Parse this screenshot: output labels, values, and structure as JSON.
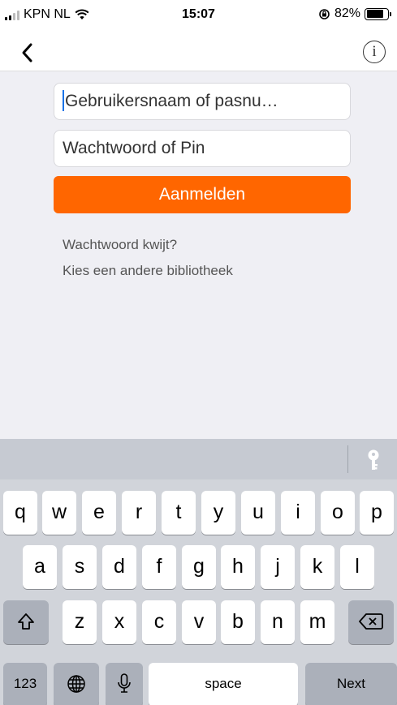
{
  "status_bar": {
    "carrier": "KPN NL",
    "time": "15:07",
    "battery_percent": "82%",
    "battery_level": 0.82
  },
  "nav": {
    "back_icon": "chevron-left-icon",
    "info_icon": "info-circle-icon",
    "info_glyph": "i"
  },
  "form": {
    "username_placeholder": "Gebruikersnaam of pasnu…",
    "password_placeholder": "Wachtwoord of Pin",
    "login_label": "Aanmelden",
    "forgot_link": "Wachtwoord kwijt?",
    "other_library_link": "Kies een andere bibliotheek",
    "accent_color": "#ff6600"
  },
  "keyboard": {
    "row1": [
      "q",
      "w",
      "e",
      "r",
      "t",
      "y",
      "u",
      "i",
      "o",
      "p"
    ],
    "row2": [
      "a",
      "s",
      "d",
      "f",
      "g",
      "h",
      "j",
      "k",
      "l"
    ],
    "row3": [
      "z",
      "x",
      "c",
      "v",
      "b",
      "n",
      "m"
    ],
    "numbers_label": "123",
    "space_label": "space",
    "next_label": "Next",
    "toolbar_icon": "key-icon"
  }
}
